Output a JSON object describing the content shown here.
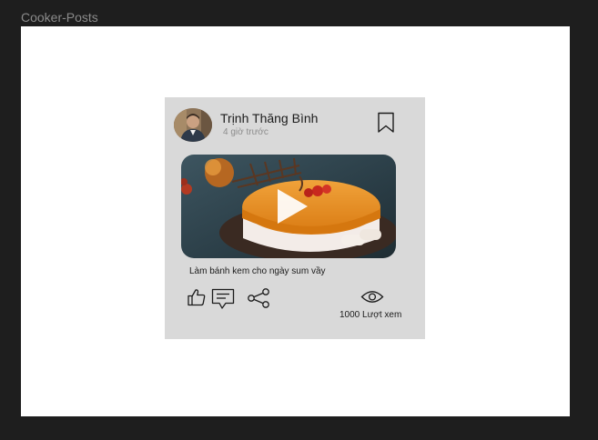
{
  "frame": {
    "label": "Cooker-Posts"
  },
  "post": {
    "author": "Trịnh Thăng Bình",
    "time": "4 giờ trước",
    "caption": "Làm bánh kem cho ngày sum vầy",
    "views": "1000 Lượt xem"
  },
  "icons": {
    "bookmark": "bookmark-icon",
    "play": "play-icon",
    "like": "thumbs-up-icon",
    "comment": "comment-icon",
    "share": "share-icon",
    "views": "eye-icon"
  },
  "colors": {
    "canvas": "#1e1e1e",
    "frame": "#ffffff",
    "card": "#d9d9d9",
    "cake_glaze": "#e58a1f"
  }
}
